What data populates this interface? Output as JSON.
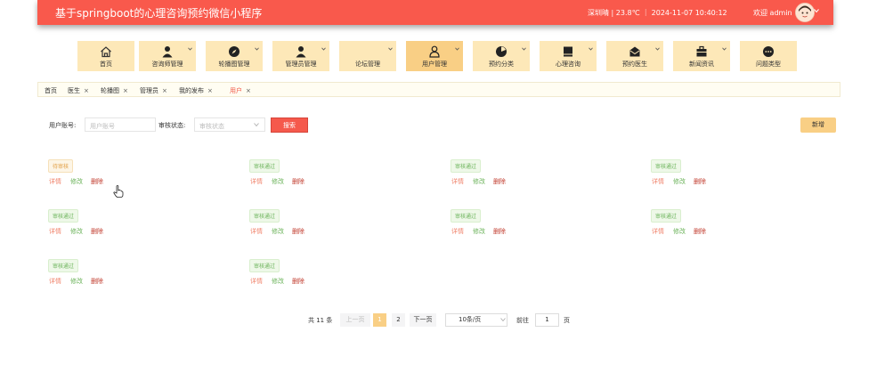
{
  "header": {
    "title": "基于springboot的心理咨询预约微信小程序",
    "info": "深圳晴 | 23.8℃ ｜ 2024-11-07  10:40:12",
    "welcome": "欢迎 admin",
    "bg_color": "#f9594c"
  },
  "nav": {
    "items": [
      {
        "label": "首页",
        "icon": "home-icon"
      },
      {
        "label": "咨询师管理",
        "icon": "user-icon"
      },
      {
        "label": "轮播图管理",
        "icon": "compass-icon"
      },
      {
        "label": "管理员管理",
        "icon": "user-icon"
      },
      {
        "label": "论坛管理",
        "icon": "document-icon"
      },
      {
        "label": "用户管理",
        "icon": "person-icon"
      },
      {
        "label": "预约分类",
        "icon": "pie-icon"
      },
      {
        "label": "心理咨询",
        "icon": "monitor-icon"
      },
      {
        "label": "预约医生",
        "icon": "mail-icon"
      },
      {
        "label": "新闻资讯",
        "icon": "briefcase-icon"
      },
      {
        "label": "问题类型",
        "icon": "more-icon"
      }
    ],
    "active_index": 5,
    "active_color": "#f9cf85",
    "item_color": "#fde8b8"
  },
  "tags": [
    {
      "label": "首页"
    },
    {
      "label": "医生"
    },
    {
      "label": "轮播图"
    },
    {
      "label": "管理员"
    },
    {
      "label": "我的发布"
    },
    {
      "label": "用户"
    }
  ],
  "search": {
    "account_label": "用户账号:",
    "account_placeholder": "用户账号",
    "status_label": "审核状态:",
    "status_placeholder": "审核状态",
    "search_button": "搜索",
    "add_button": "新增"
  },
  "cards": [
    {
      "status": "待审核",
      "pending": true
    },
    {
      "status": "审核通过",
      "pending": false
    },
    {
      "status": "审核通过",
      "pending": false
    },
    {
      "status": "审核通过",
      "pending": false
    },
    {
      "status": "审核通过",
      "pending": false
    },
    {
      "status": "审核通过",
      "pending": false
    },
    {
      "status": "审核通过",
      "pending": false
    },
    {
      "status": "审核通过",
      "pending": false
    },
    {
      "status": "审核通过",
      "pending": false
    },
    {
      "status": "审核通过",
      "pending": false
    }
  ],
  "actions": {
    "detail": "详情",
    "edit": "修改",
    "delete": "删除"
  },
  "pagination": {
    "total": "共 11 条",
    "prev": "上一页",
    "next": "下一页",
    "pages": [
      "1",
      "2"
    ],
    "current": "1",
    "page_size": "10条/页",
    "goto_label": "前往",
    "goto_value": "1",
    "page_unit": "页"
  }
}
